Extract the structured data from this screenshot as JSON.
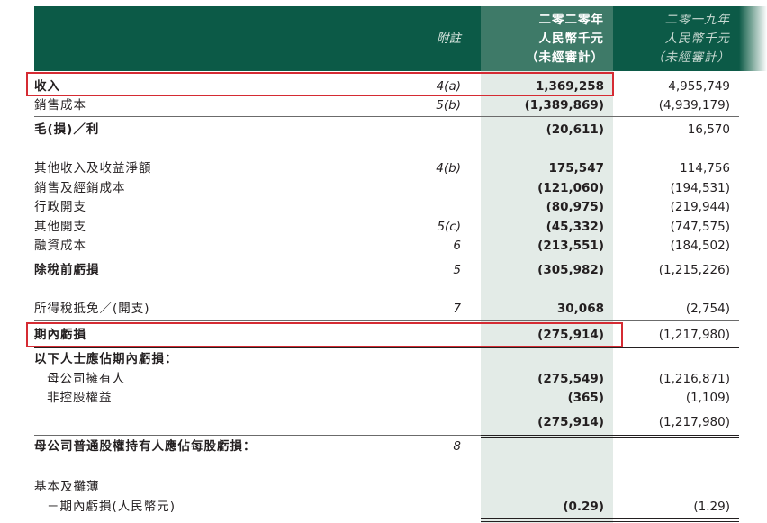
{
  "header": {
    "note_label": "附註",
    "current_year": [
      "二零二零年",
      "人民幣千元",
      "（未經審計）"
    ],
    "prior_year": [
      "二零一九年",
      "人民幣千元",
      "（未經審計）"
    ]
  },
  "rows": [
    {
      "label": "收入",
      "note": "4(a)",
      "current": "1,369,258",
      "prior": "4,955,749"
    },
    {
      "label": "銷售成本",
      "note": "5(b)",
      "current": "(1,389,869)",
      "prior": "(4,939,179)"
    },
    {
      "label": "毛(損)／利",
      "note": "",
      "current": "(20,611)",
      "prior": "16,570"
    },
    {
      "label": "其他收入及收益淨額",
      "note": "4(b)",
      "current": "175,547",
      "prior": "114,756"
    },
    {
      "label": "銷售及經銷成本",
      "note": "",
      "current": "(121,060)",
      "prior": "(194,531)"
    },
    {
      "label": "行政開支",
      "note": "",
      "current": "(80,975)",
      "prior": "(219,944)"
    },
    {
      "label": "其他開支",
      "note": "5(c)",
      "current": "(45,332)",
      "prior": "(747,575)"
    },
    {
      "label": "融資成本",
      "note": "6",
      "current": "(213,551)",
      "prior": "(184,502)"
    },
    {
      "label": "除稅前虧損",
      "note": "5",
      "current": "(305,982)",
      "prior": "(1,215,226)"
    },
    {
      "label": "所得稅抵免／(開支)",
      "note": "7",
      "current": "30,068",
      "prior": "(2,754)"
    },
    {
      "label": "期內虧損",
      "note": "",
      "current": "(275,914)",
      "prior": "(1,217,980)"
    },
    {
      "label": "以下人士應佔期內虧損：",
      "note": "",
      "current": "",
      "prior": ""
    },
    {
      "label": "母公司擁有人",
      "note": "",
      "current": "(275,549)",
      "prior": "(1,216,871)"
    },
    {
      "label": "非控股權益",
      "note": "",
      "current": "(365)",
      "prior": "(1,109)"
    },
    {
      "label": "",
      "note": "",
      "current": "(275,914)",
      "prior": "(1,217,980)"
    },
    {
      "label": "母公司普通股權持有人應佔每股虧損：",
      "note": "8",
      "current": "",
      "prior": ""
    },
    {
      "label": "基本及攤薄",
      "note": "",
      "current": "",
      "prior": ""
    },
    {
      "label": "－期內虧損(人民幣元)",
      "note": "",
      "current": "(0.29)",
      "prior": "(1.29)"
    }
  ],
  "colors": {
    "header_green": "#0c5a47",
    "current_column_shade": "#e3ebe7",
    "highlight_red": "#d52b33"
  }
}
